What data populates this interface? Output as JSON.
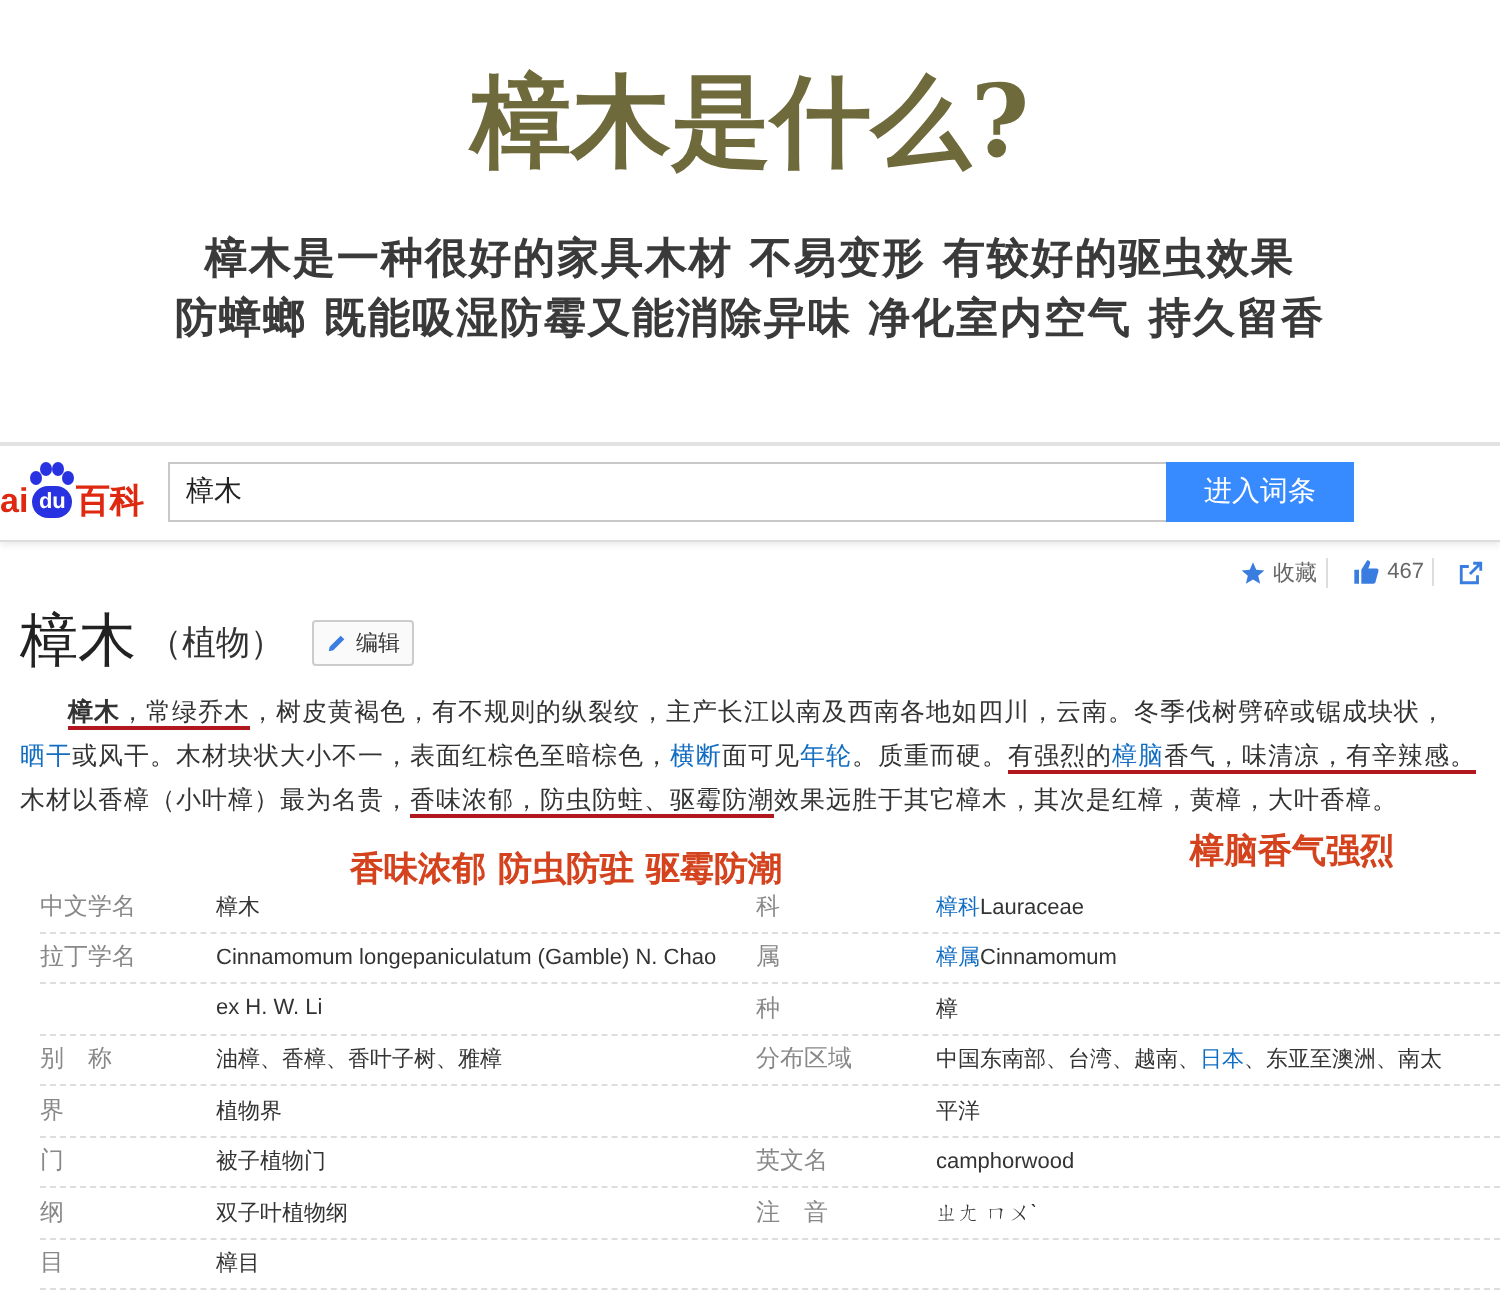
{
  "hero": {
    "title": "樟木是什么?",
    "lines": [
      "樟木是一种很好的家具木材 不易变形 有较好的驱虫效果",
      "防蟑螂 既能吸湿防霉又能消除异味 净化室内空气 持久留香"
    ]
  },
  "search": {
    "logo": {
      "left": "ai",
      "mark": "du",
      "right": "百科"
    },
    "query": "樟木",
    "button": "进入词条"
  },
  "toolbar": [
    {
      "kind": "star",
      "label": "收藏"
    },
    {
      "kind": "like",
      "label": "467"
    },
    {
      "kind": "share"
    }
  ],
  "heading": {
    "title": "樟木",
    "subtitle": "（植物）",
    "edit": "编辑"
  },
  "paragraph": [
    {
      "kind": "bold",
      "text": "樟木",
      "underlined": true
    },
    {
      "kind": "plain",
      "text": "，常绿乔木",
      "underlined": true
    },
    {
      "kind": "plain",
      "text": "，树皮黄褐色，有不规则的纵裂纹，主产长江以南及西南各地如四川，云南。冬季伐树劈碎或锯成块状，",
      "underlined": false
    },
    {
      "kind": "link",
      "text": "晒干",
      "underlined": false
    },
    {
      "kind": "plain",
      "text": "或风干。木材块状大小不一，表面红棕色至暗棕色，",
      "underlined": false
    },
    {
      "kind": "link",
      "text": "横断",
      "underlined": false
    },
    {
      "kind": "plain",
      "text": "面可见",
      "underlined": false
    },
    {
      "kind": "link",
      "text": "年轮",
      "underlined": false
    },
    {
      "kind": "plain",
      "text": "。质重而硬。",
      "underlined": false
    },
    {
      "kind": "plain",
      "text": "有强烈的",
      "underlined": true
    },
    {
      "kind": "link",
      "text": "樟脑",
      "underlined": true
    },
    {
      "kind": "plain",
      "text": "香气，味清凉，有辛辣感。",
      "underlined": true
    },
    {
      "kind": "plain",
      "text": "木材以香樟（小叶樟）最为名贵，",
      "underlined": false
    },
    {
      "kind": "plain",
      "text": "香味浓郁，防虫防蛀、驱霉防潮",
      "underlined": true
    },
    {
      "kind": "plain",
      "text": "效果远胜于其它樟木，其次是红樟，黄樟，大叶香樟。",
      "underlined": false
    }
  ],
  "annotations": [
    {
      "text": "香味浓郁 防虫防驻 驱霉防潮"
    },
    {
      "text": "樟脑香气强烈"
    }
  ],
  "infobox": [
    {
      "label": "中文学名",
      "value": [
        {
          "text": "樟木",
          "link": false
        }
      ],
      "label_2": "科",
      "value_2": [
        {
          "text": "樟科",
          "link": true
        },
        {
          "text": "Lauraceae",
          "link": false
        }
      ]
    },
    {
      "label": "拉丁学名",
      "value": [
        {
          "text": "Cinnamomum longepaniculatum (Gamble) N. Chao",
          "link": false
        }
      ],
      "label_2": "属",
      "value_2": [
        {
          "text": "樟属",
          "link": true
        },
        {
          "text": "Cinnamomum",
          "link": false
        }
      ]
    },
    {
      "value": [
        {
          "text": "ex H. W. Li",
          "link": false
        }
      ],
      "label_2": "种",
      "value_2": [
        {
          "text": "樟",
          "link": false
        }
      ]
    },
    {
      "label": "别　称",
      "value": [
        {
          "text": "油樟、香樟、香叶子树、雅樟",
          "link": false
        }
      ],
      "label_2": "分布区域",
      "value_2": [
        {
          "text": "中国东南部、台湾、越南、",
          "link": false
        },
        {
          "text": "日本",
          "link": true
        },
        {
          "text": "、东亚至澳洲、南太",
          "link": false
        }
      ]
    },
    {
      "label": "界",
      "value": [
        {
          "text": "植物界",
          "link": false
        }
      ],
      "value_2": [
        {
          "text": "平洋",
          "link": false
        }
      ]
    },
    {
      "label": "门",
      "value": [
        {
          "text": "被子植物门",
          "link": false
        }
      ],
      "label_2": "英文名",
      "value_2": [
        {
          "text": "camphorwood",
          "link": false
        }
      ]
    },
    {
      "label": "纲",
      "value": [
        {
          "text": "双子叶植物纲",
          "link": false
        }
      ],
      "label_2": "注　音",
      "value_2": [
        {
          "text": "ㄓㄤ ㄇㄨˋ",
          "link": false
        }
      ]
    },
    {
      "label": "目",
      "value": [
        {
          "text": "樟目",
          "link": false
        }
      ]
    }
  ]
}
